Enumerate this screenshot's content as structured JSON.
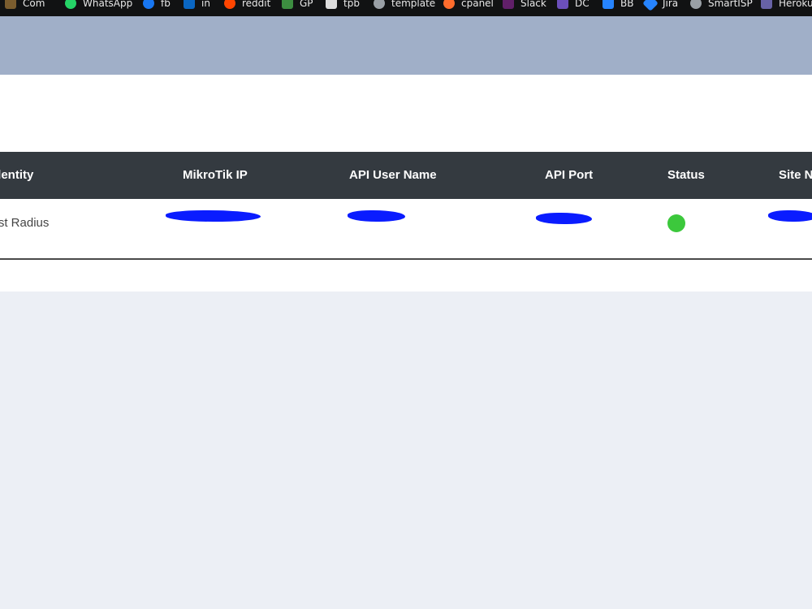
{
  "bookmarks": [
    {
      "label": "Com",
      "icon": "stacked-bars-icon",
      "color": "#7a5c2e"
    },
    {
      "label": "WhatsApp",
      "icon": "whatsapp-icon",
      "color": "#25d366"
    },
    {
      "label": "fb",
      "icon": "facebook-icon",
      "color": "#1877f2"
    },
    {
      "label": "in",
      "icon": "linkedin-icon",
      "color": "#0a66c2"
    },
    {
      "label": "reddit",
      "icon": "reddit-icon",
      "color": "#ff4500"
    },
    {
      "label": "GP",
      "icon": "puzzle-icon",
      "color": "#3c8d40"
    },
    {
      "label": "tpb",
      "icon": "ship-icon",
      "color": "#dddddd"
    },
    {
      "label": "template",
      "icon": "globe-icon",
      "color": "#9aa0a6"
    },
    {
      "label": "cpanel",
      "icon": "cpanel-icon",
      "color": "#ff6c2c"
    },
    {
      "label": "Slack",
      "icon": "slack-icon",
      "color": "#611f69"
    },
    {
      "label": "DC",
      "icon": "doc-icon",
      "color": "#6b4fbb"
    },
    {
      "label": "BB",
      "icon": "bitbucket-icon",
      "color": "#2684ff"
    },
    {
      "label": "Jira",
      "icon": "jira-icon",
      "color": "#2684ff"
    },
    {
      "label": "SmartISP",
      "icon": "globe-icon",
      "color": "#9aa0a6"
    },
    {
      "label": "Heroku",
      "icon": "heroku-icon",
      "color": "#6762a6"
    }
  ],
  "table": {
    "headers": [
      "Identity",
      "MikroTik IP",
      "API User Name",
      "API Port",
      "Status",
      "Site Name"
    ],
    "rows": [
      {
        "identity": "Test Radius",
        "mikrotik_ip": "",
        "api_user": "",
        "api_port": "",
        "status": "online",
        "site_name": ""
      }
    ]
  },
  "colors": {
    "header_band": "#a0afc8",
    "table_head": "#343a40",
    "status_online": "#3cc83c",
    "redaction": "#0a1cff",
    "page_bg": "#eceff5"
  }
}
